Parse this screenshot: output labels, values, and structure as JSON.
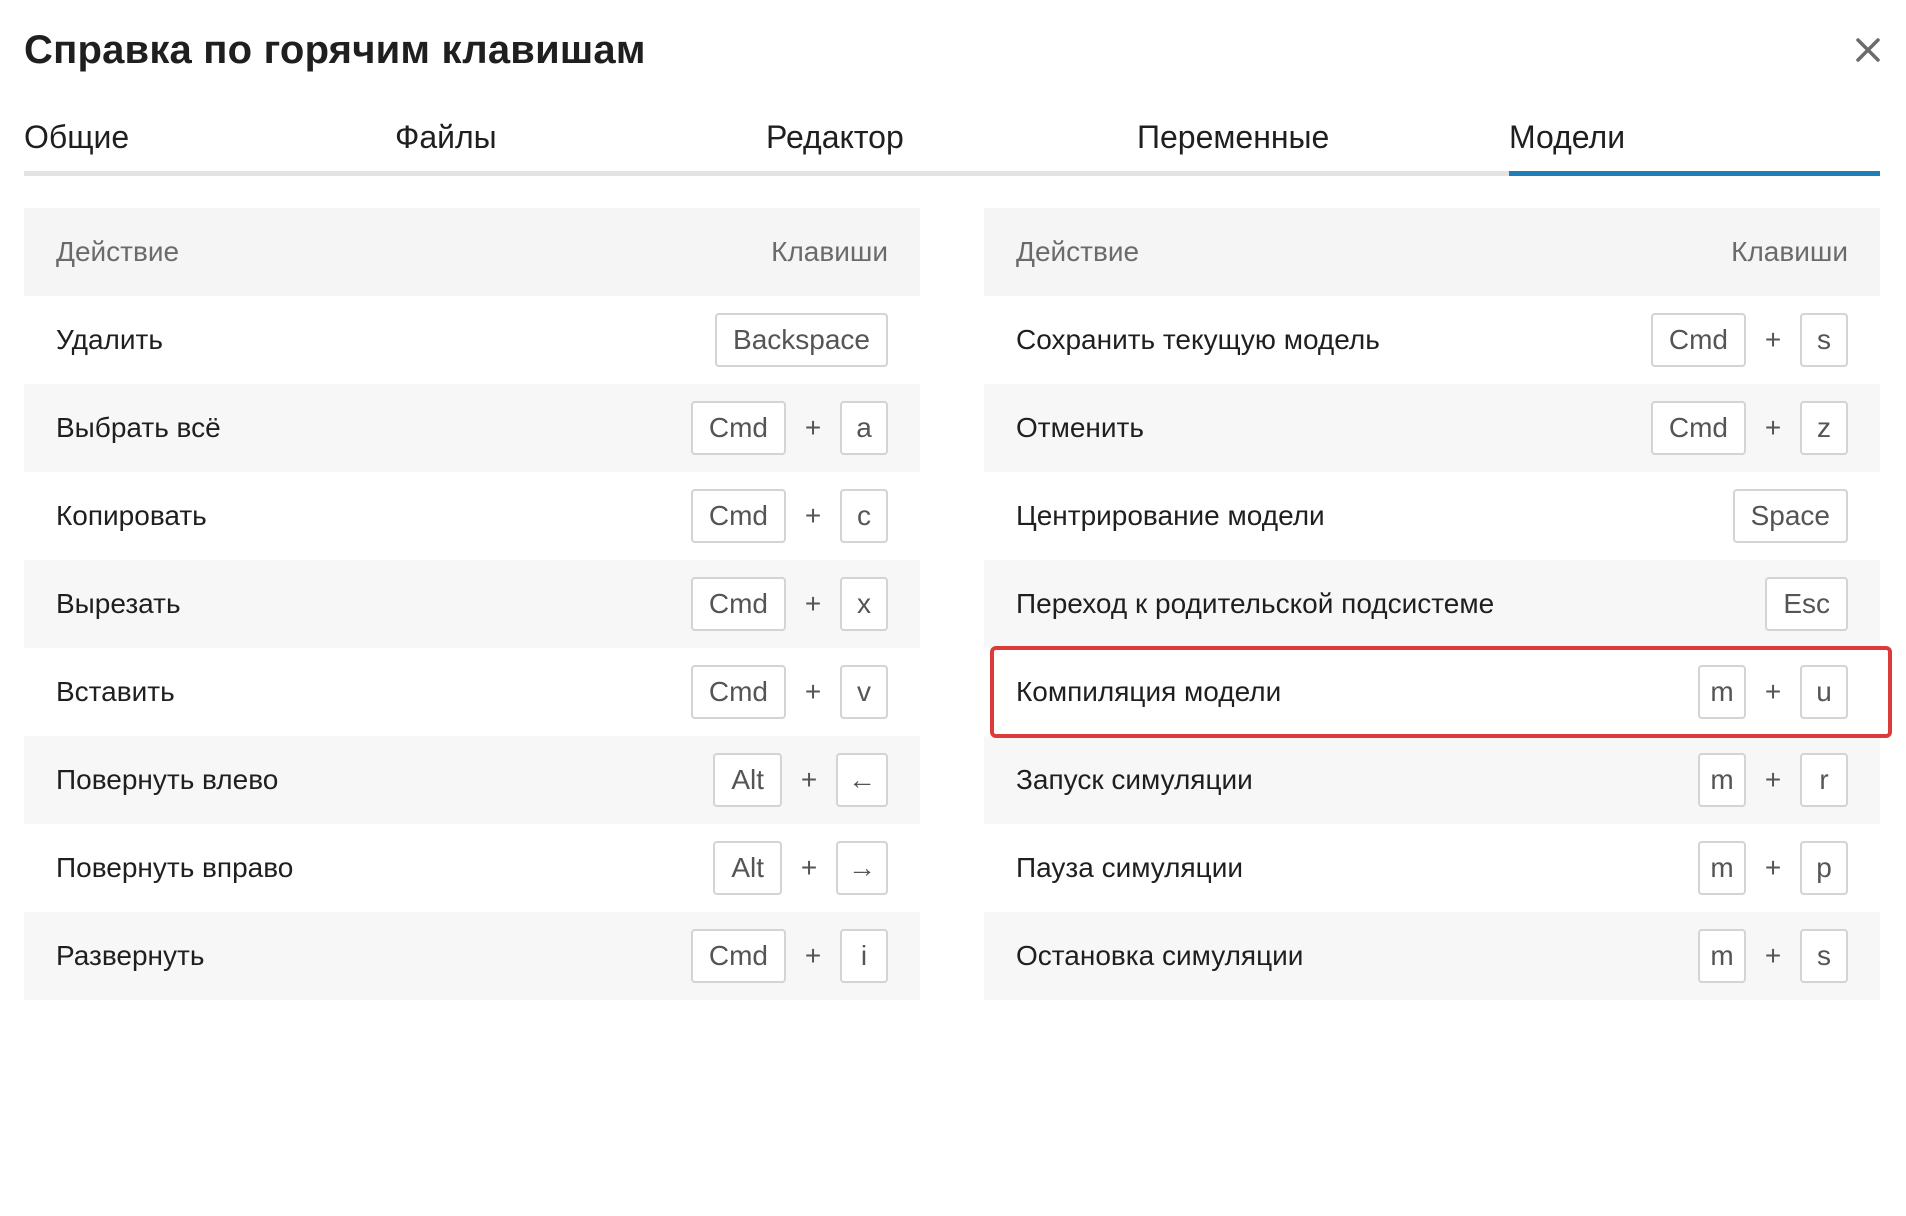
{
  "dialog": {
    "title": "Справка по горячим клавишам",
    "close_icon": "close-icon"
  },
  "tabs": [
    {
      "label": "Общие",
      "active": false
    },
    {
      "label": "Файлы",
      "active": false
    },
    {
      "label": "Редактор",
      "active": false
    },
    {
      "label": "Переменные",
      "active": false
    },
    {
      "label": "Модели",
      "active": true
    }
  ],
  "colors": {
    "accent": "#1e7fb8",
    "highlight": "#dc3b37",
    "row_alt": "#f7f7f7"
  },
  "left_table": {
    "header": {
      "action": "Действие",
      "keys": "Клавиши"
    },
    "rows": [
      {
        "action": "Удалить",
        "keys": [
          "Backspace"
        ]
      },
      {
        "action": "Выбрать всё",
        "keys": [
          "Cmd",
          "a"
        ]
      },
      {
        "action": "Копировать",
        "keys": [
          "Cmd",
          "c"
        ]
      },
      {
        "action": "Вырезать",
        "keys": [
          "Cmd",
          "x"
        ]
      },
      {
        "action": "Вставить",
        "keys": [
          "Cmd",
          "v"
        ]
      },
      {
        "action": "Повернуть влево",
        "keys": [
          "Alt",
          "←"
        ]
      },
      {
        "action": "Повернуть вправо",
        "keys": [
          "Alt",
          "→"
        ]
      },
      {
        "action": "Развернуть",
        "keys": [
          "Cmd",
          "i"
        ]
      }
    ]
  },
  "right_table": {
    "header": {
      "action": "Действие",
      "keys": "Клавиши"
    },
    "rows": [
      {
        "action": "Сохранить текущую модель",
        "keys": [
          "Cmd",
          "s"
        ]
      },
      {
        "action": "Отменить",
        "keys": [
          "Cmd",
          "z"
        ]
      },
      {
        "action": "Центрирование модели",
        "keys": [
          "Space"
        ]
      },
      {
        "action": "Переход к родительской подсистеме",
        "keys": [
          "Esc"
        ]
      },
      {
        "action": "Компиляция модели",
        "keys": [
          "m",
          "u"
        ],
        "highlighted": true
      },
      {
        "action": "Запуск симуляции",
        "keys": [
          "m",
          "r"
        ]
      },
      {
        "action": "Пауза симуляции",
        "keys": [
          "m",
          "p"
        ]
      },
      {
        "action": "Остановка симуляции",
        "keys": [
          "m",
          "s"
        ]
      }
    ]
  },
  "key_separator": "+"
}
